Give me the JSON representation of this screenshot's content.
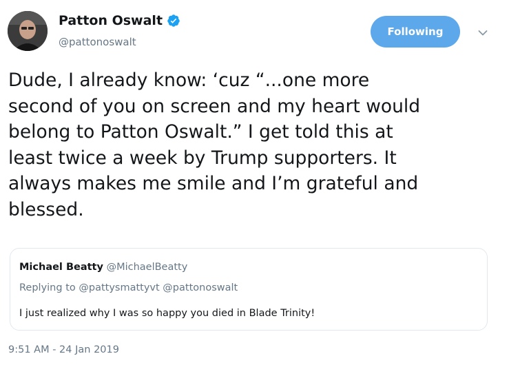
{
  "author": {
    "display_name": "Patton Oswalt",
    "handle": "@pattonoswalt",
    "verified_icon": "verified-badge-icon",
    "avatar_icon": "profile-photo"
  },
  "follow_button": {
    "label": "Following"
  },
  "menu": {
    "icon": "chevron-down-icon"
  },
  "tweet": {
    "lines": [
      "Dude, I already know: ‘cuz “...one more",
      "second of you on screen and my heart would",
      "belong to Patton Oswalt.” I get told this at",
      "least twice a week by Trump supporters. It",
      "always makes me smile and I’m grateful and",
      "blessed."
    ]
  },
  "quoted_tweet": {
    "name": "Michael Beatty",
    "handle": "@MichaelBeatty",
    "replying_to_prefix": "Replying to",
    "replying_to_1": "@pattysmattyvt",
    "replying_to_2": "@pattonoswalt",
    "text": "I just realized why I was so happy you died in Blade Trinity!"
  },
  "timestamp": "9:51 AM - 24 Jan 2019",
  "colors": {
    "accent": "#5da8ea",
    "verified": "#1da1f2",
    "muted": "#657786",
    "border": "#e1e8ed"
  }
}
